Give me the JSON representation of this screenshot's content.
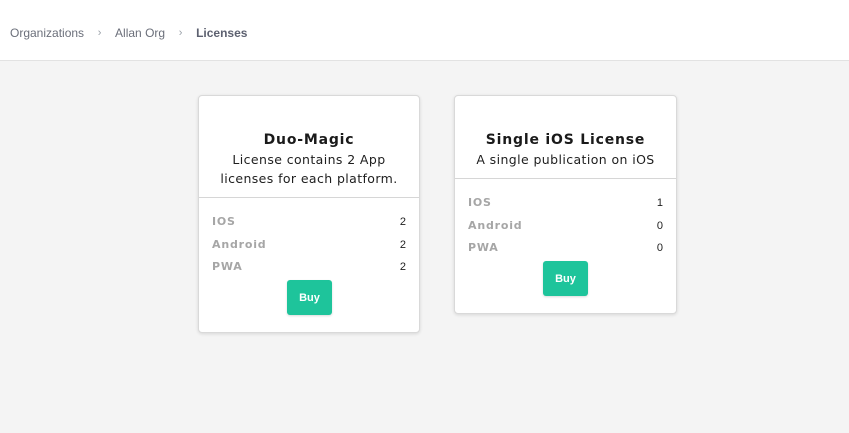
{
  "breadcrumb": {
    "items": [
      "Organizations",
      "Allan Org"
    ],
    "separator": "›",
    "current": "Licenses"
  },
  "licenses": [
    {
      "title": "Duo-Magic",
      "description_lines": [
        "License contains 2 App",
        "licenses for each platform."
      ],
      "rows": [
        {
          "label": "IOS",
          "value": "2"
        },
        {
          "label": "Android",
          "value": "2"
        },
        {
          "label": "PWA",
          "value": "2"
        }
      ],
      "buy_label": "Buy"
    },
    {
      "title": "Single iOS License",
      "description_lines": [
        "A single publication on iOS"
      ],
      "rows": [
        {
          "label": "IOS",
          "value": "1"
        },
        {
          "label": "Android",
          "value": "0"
        },
        {
          "label": "PWA",
          "value": "0"
        }
      ],
      "buy_label": "Buy"
    }
  ],
  "colors": {
    "accent": "#1ec49b",
    "background": "#f4f4f4",
    "card": "#ffffff",
    "label_gray": "#a6a6a6"
  }
}
